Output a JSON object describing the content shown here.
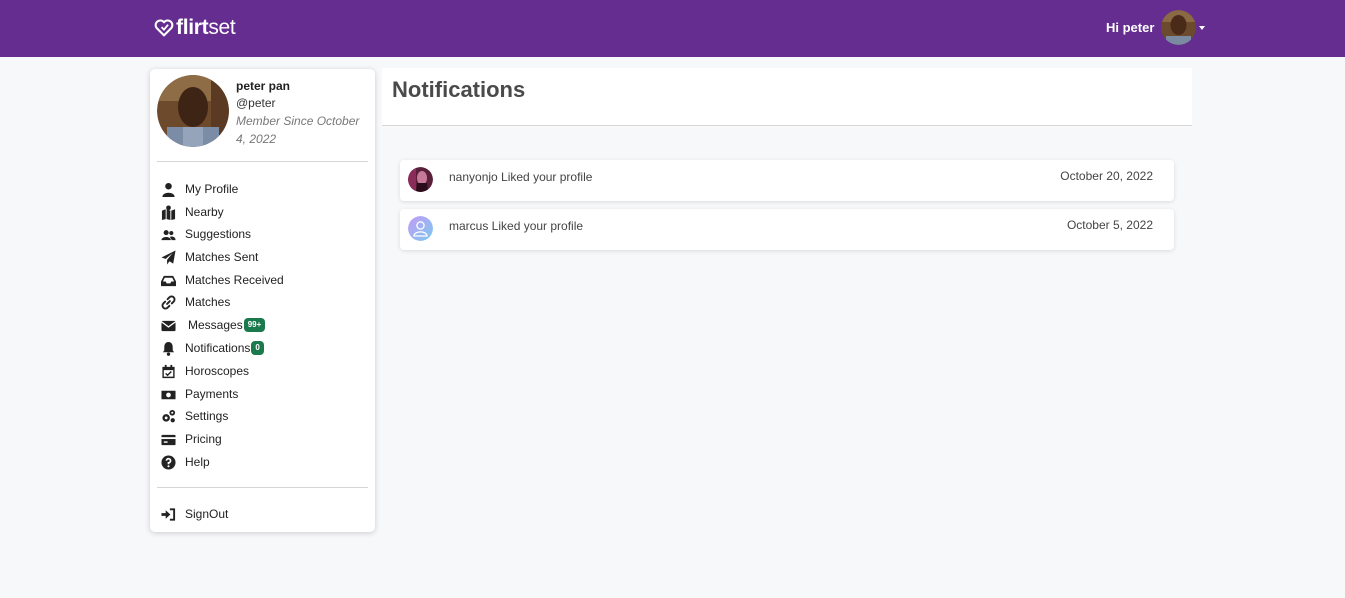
{
  "header": {
    "logo_text_bold": "flirt",
    "logo_text_light": "set",
    "greeting": "Hi peter"
  },
  "profile": {
    "name": "peter pan",
    "handle": "@peter",
    "member_since": "Member Since October 4, 2022"
  },
  "sidebar": {
    "items": [
      {
        "label": "My Profile",
        "icon": "user-icon"
      },
      {
        "label": "Nearby",
        "icon": "map-icon"
      },
      {
        "label": "Suggestions",
        "icon": "users-icon"
      },
      {
        "label": "Matches Sent",
        "icon": "paper-plane-icon"
      },
      {
        "label": "Matches Received",
        "icon": "inbox-icon"
      },
      {
        "label": "Matches",
        "icon": "link-icon"
      },
      {
        "label": "Messages",
        "icon": "envelope-icon",
        "badge": "99+"
      },
      {
        "label": "Notifications",
        "icon": "bell-icon",
        "badge": "0"
      },
      {
        "label": "Horoscopes",
        "icon": "calendar-check-icon"
      },
      {
        "label": "Payments",
        "icon": "money-icon"
      },
      {
        "label": "Settings",
        "icon": "gears-icon"
      },
      {
        "label": "Pricing",
        "icon": "credit-card-icon"
      },
      {
        "label": "Help",
        "icon": "question-circle-icon"
      }
    ],
    "signout": {
      "label": "SignOut",
      "icon": "sign-in-icon"
    }
  },
  "main": {
    "title": "Notifications",
    "notifications": [
      {
        "text": "nanyonjo Liked your profile",
        "date": "October 20, 2022"
      },
      {
        "text": "marcus Liked your profile",
        "date": "October 5, 2022"
      }
    ]
  },
  "colors": {
    "brand": "#662d91",
    "badge": "#1b7a4d"
  }
}
